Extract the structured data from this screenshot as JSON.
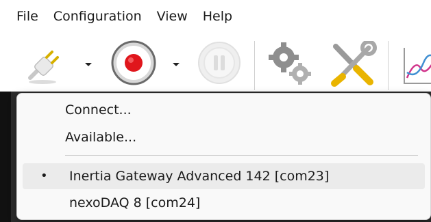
{
  "menubar": {
    "items": [
      {
        "label": "File"
      },
      {
        "label": "Configuration"
      },
      {
        "label": "View"
      },
      {
        "label": "Help"
      }
    ]
  },
  "toolbar": {
    "connect_icon": "plug-icon",
    "record_icon": "record-icon",
    "pause_icon": "pause-icon",
    "settings_icon": "gears-icon",
    "tools_icon": "tools-icon",
    "chart_icon": "chart-icon",
    "pause_enabled": false
  },
  "dropdown": {
    "actions": [
      {
        "label": "Connect..."
      },
      {
        "label": "Available..."
      }
    ],
    "devices": [
      {
        "label": "Inertia Gateway Advanced 142 [com23]",
        "selected": true
      },
      {
        "label": "nexoDAQ 8 [com24]",
        "selected": false
      }
    ],
    "selected_marker": "•"
  },
  "colors": {
    "record_red": "#e0161c",
    "menu_bg": "#f9f9f9",
    "highlight": "#ebebeb"
  }
}
